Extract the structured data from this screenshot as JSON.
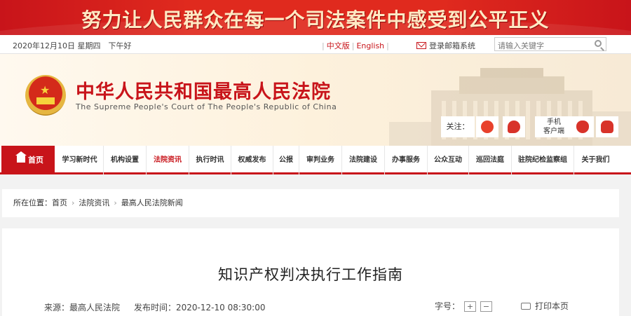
{
  "banner": {
    "slogan": "努力让人民群众在每一个司法案件中感受到公平正义"
  },
  "topbar": {
    "date": "2020年12月10日 星期四　下午好",
    "lang_cn": "中文版",
    "lang_en": "English",
    "mailbox": "登录邮箱系统",
    "search_placeholder": "请输入关键字"
  },
  "header": {
    "title": "中华人民共和国最高人民法院",
    "subtitle": "The Supreme People's Court of The People's Republic of China",
    "follow_label": "关注：",
    "mobile_line1": "手机",
    "mobile_line2": "客户端"
  },
  "nav": {
    "home": "首页",
    "items": [
      "学习新时代",
      "机构设置",
      "法院资讯",
      "执行时讯",
      "权威发布",
      "公报",
      "审判业务",
      "法院建设",
      "办事服务",
      "公众互动",
      "巡回法庭",
      "驻院纪检监察组",
      "关于我们"
    ],
    "active_index": 2
  },
  "breadcrumb": {
    "prefix": "所在位置：",
    "levels": [
      "首页",
      "法院资讯",
      "最高人民法院新闻"
    ]
  },
  "article": {
    "title": "知识产权判决执行工作指南",
    "source": "来源：最高人民法院",
    "published": "发布时间：2020-12-10 08:30:00",
    "font_size_label": "字号：",
    "font_plus": "+",
    "font_minus": "−",
    "print": "打印本页"
  }
}
